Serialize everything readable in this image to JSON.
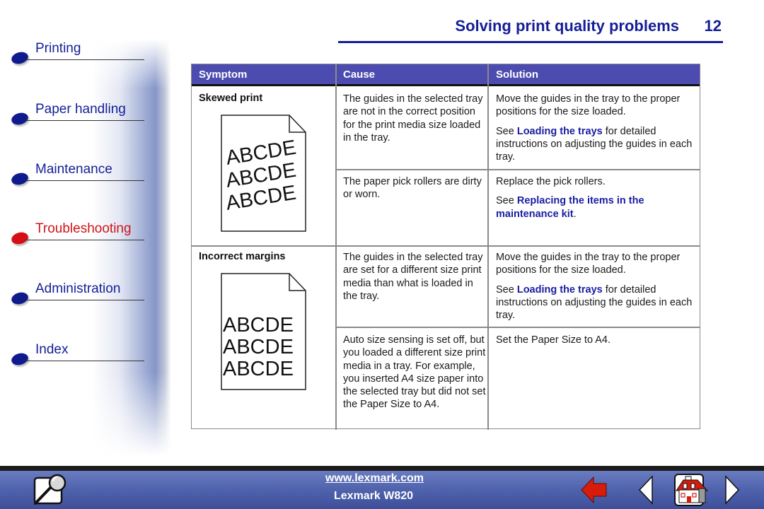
{
  "header": {
    "title": "Solving print quality problems",
    "page_number": "12"
  },
  "sidebar": {
    "items": [
      {
        "label": "Printing",
        "active": false
      },
      {
        "label": "Paper handling",
        "active": false
      },
      {
        "label": "Maintenance",
        "active": false
      },
      {
        "label": "Troubleshooting",
        "active": true
      },
      {
        "label": "Administration",
        "active": false
      },
      {
        "label": "Index",
        "active": false
      }
    ]
  },
  "table": {
    "columns": [
      "Symptom",
      "Cause",
      "Solution"
    ],
    "rows": [
      {
        "symptom": "Skewed print",
        "illustration": {
          "text_lines": [
            "ABCDE",
            "ABCDE",
            "ABCDE"
          ],
          "style": "skewed"
        },
        "causes": [
          {
            "cause": "The guides in the selected tray are not in the correct position for the print media size loaded in the tray.",
            "solution_text": "Move the guides in the tray to the proper positions for the size loaded.",
            "see_prefix": "See ",
            "see_link": "Loading the trays",
            "see_suffix": " for detailed instructions on adjusting the guides in each tray."
          },
          {
            "cause": "The paper pick rollers are dirty or worn.",
            "solution_text": "Replace the pick rollers.",
            "see_prefix": "See ",
            "see_link": "Replacing the items in the maintenance kit",
            "see_suffix": "."
          }
        ]
      },
      {
        "symptom": "Incorrect margins",
        "illustration": {
          "text_lines": [
            "ABCDE",
            "ABCDE",
            "ABCDE"
          ],
          "style": "shifted"
        },
        "causes": [
          {
            "cause": "The guides in the selected tray are set for a different size print media than what is loaded in the tray.",
            "solution_text": "Move the guides in the tray to the proper positions for the size loaded.",
            "see_prefix": "See ",
            "see_link": "Loading the trays",
            "see_suffix": " for detailed instructions on adjusting the guides in each tray."
          },
          {
            "cause": "Auto size sensing is set off, but you loaded a different size print media in a tray. For example, you inserted A4 size paper into the selected tray but did not set the Paper Size to A4.",
            "solution_text": "Set the Paper Size to A4."
          }
        ]
      }
    ]
  },
  "footer": {
    "url": "www.lexmark.com",
    "model": "Lexmark W820",
    "icons": [
      "search-icon",
      "back-arrow-icon",
      "previous-page-icon",
      "home-icon",
      "next-page-icon"
    ]
  },
  "colors": {
    "accent": "#141e96",
    "active": "#d01418",
    "table_header": "#4c4cb0",
    "footer": "#4f62ac"
  }
}
